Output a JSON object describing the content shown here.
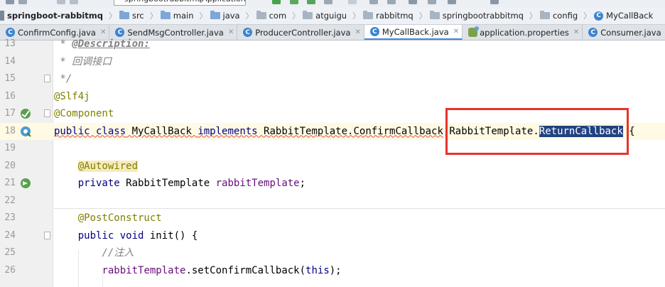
{
  "breadcrumb": {
    "project": "springboot-rabbitmq",
    "items": [
      "src",
      "main",
      "java",
      "com",
      "atguigu",
      "rabbitmq",
      "springbootrabbitmq",
      "config"
    ],
    "current": "MyCallBack"
  },
  "toolbar": {
    "run_config_partial": "springbootrabbitmqApplication"
  },
  "tabs": [
    {
      "label": "ConfirmConfig.java",
      "icon": "class-icon",
      "active": false
    },
    {
      "label": "SendMsgController.java",
      "icon": "class-icon",
      "active": false
    },
    {
      "label": "ProducerController.java",
      "icon": "class-icon",
      "active": false
    },
    {
      "label": "MyCallBack.java",
      "icon": "class-icon",
      "active": true
    },
    {
      "label": "application.properties",
      "icon": "properties-icon",
      "active": false
    },
    {
      "label": "Consumer.java",
      "icon": "class-icon",
      "active": false
    }
  ],
  "editor": {
    "line_numbers": [
      "13",
      "14",
      "15",
      "16",
      "17",
      "18",
      "19",
      "20",
      "21",
      "22",
      "23",
      "24",
      "25",
      "26"
    ],
    "current_line": "18",
    "code": {
      "l13_star": " * ",
      "l13_tag": "@Description:",
      "l14": " * 回调接口",
      "l15": " */",
      "l16": "@Slf4j",
      "l17": "@Component",
      "l18_kw": "public class",
      "l18_name": " MyCallBack ",
      "l18_impl": "implements",
      "l18_type1": " RabbitTemplate.ConfirmCallback",
      "l18_comma": ",",
      "l18_type2": "RabbitTemplate.",
      "l18_selected": "ReturnCallback",
      "l18_brace": " {",
      "l20": "@Autowired",
      "l21_kw": "private",
      "l21_type_a": " RabbitTempla",
      "l21_type_b": "te ",
      "l21_field": "rabbitTemplate",
      "l21_end": ";",
      "l23": "@PostConstruct",
      "l24_kw": "public void",
      "l24_rest": " init() {",
      "l25": "//注入",
      "l26_field": "rabbitTemplate",
      "l26_call": ".setConfirmCallback(",
      "l26_this": "this",
      "l26_end": ");"
    }
  }
}
